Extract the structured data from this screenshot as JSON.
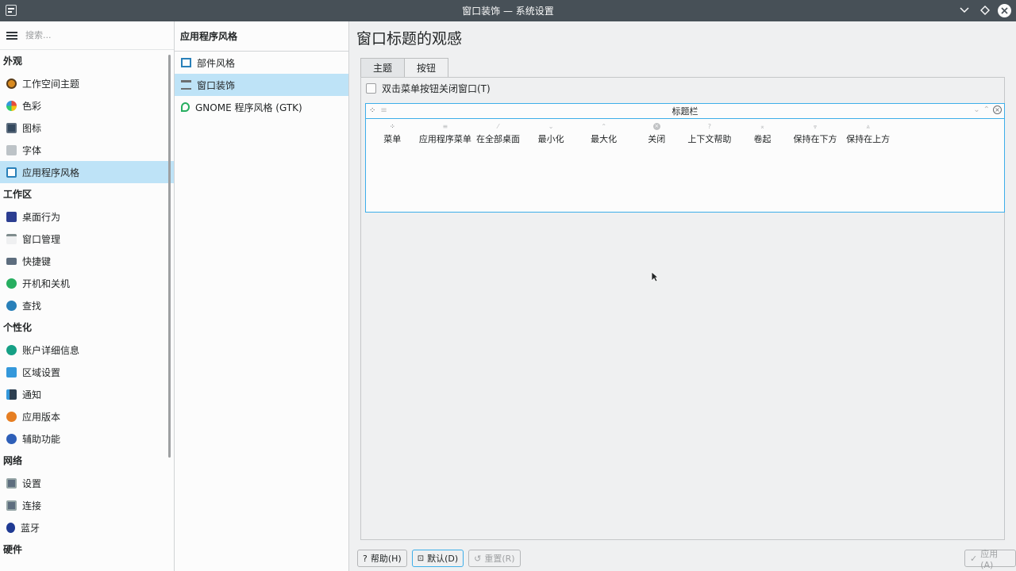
{
  "window": {
    "title": "窗口装饰 — 系统设置"
  },
  "search": {
    "placeholder": "搜索..."
  },
  "sidebar": {
    "categories": [
      {
        "label": "外观",
        "items": [
          {
            "label": "工作空间主题",
            "icon": "workspace-theme-icon"
          },
          {
            "label": "色彩",
            "icon": "colors-icon"
          },
          {
            "label": "图标",
            "icon": "icons-icon"
          },
          {
            "label": "字体",
            "icon": "fonts-icon"
          },
          {
            "label": "应用程序风格",
            "icon": "app-style-icon",
            "selected": true
          }
        ]
      },
      {
        "label": "工作区",
        "items": [
          {
            "label": "桌面行为",
            "icon": "desktop-behavior-icon"
          },
          {
            "label": "窗口管理",
            "icon": "window-management-icon"
          },
          {
            "label": "快捷键",
            "icon": "shortcuts-icon"
          },
          {
            "label": "开机和关机",
            "icon": "startup-shutdown-icon"
          },
          {
            "label": "查找",
            "icon": "search-icon"
          }
        ]
      },
      {
        "label": "个性化",
        "items": [
          {
            "label": "账户详细信息",
            "icon": "account-details-icon"
          },
          {
            "label": "区域设置",
            "icon": "regional-settings-icon"
          },
          {
            "label": "通知",
            "icon": "notifications-icon"
          },
          {
            "label": "应用版本",
            "icon": "application-version-icon"
          },
          {
            "label": "辅助功能",
            "icon": "accessibility-icon"
          }
        ]
      },
      {
        "label": "网络",
        "items": [
          {
            "label": "设置",
            "icon": "network-settings-icon"
          },
          {
            "label": "连接",
            "icon": "connections-icon"
          },
          {
            "label": "蓝牙",
            "icon": "bluetooth-icon"
          }
        ]
      },
      {
        "label": "硬件",
        "items": []
      }
    ]
  },
  "middle": {
    "header": "应用程序风格",
    "items": [
      {
        "label": "部件风格",
        "icon": "widget-style-icon"
      },
      {
        "label": "窗口装饰",
        "icon": "window-decoration-icon",
        "selected": true
      },
      {
        "label": "GNOME 程序风格 (GTK)",
        "icon": "gtk-style-icon"
      }
    ]
  },
  "content": {
    "title": "窗口标题的观感",
    "tabs": [
      {
        "label": "主题"
      },
      {
        "label": "按钮",
        "active": true
      }
    ],
    "checkbox": {
      "label": "双击菜单按钮关闭窗口(T)",
      "checked": false
    },
    "titlebar_label": "标题栏",
    "buttons": [
      {
        "label": "菜单",
        "glyph": "⁘"
      },
      {
        "label": "应用程序菜单",
        "glyph": "≡"
      },
      {
        "label": "在全部桌面",
        "glyph": "⁄"
      },
      {
        "label": "最小化",
        "glyph": "⌄"
      },
      {
        "label": "最大化",
        "glyph": "⌃"
      },
      {
        "label": "关闭",
        "glyph": "×"
      },
      {
        "label": "上下文帮助",
        "glyph": "?"
      },
      {
        "label": "卷起",
        "glyph": "⌅"
      },
      {
        "label": "保持在下方",
        "glyph": "⩔"
      },
      {
        "label": "保持在上方",
        "glyph": "⩓"
      }
    ],
    "footer": {
      "help": "帮助(H)",
      "defaults": "默认(D)",
      "reset": "重置(R)",
      "apply": "应用(A)"
    }
  },
  "colors": {
    "accent": "#3daee9",
    "selection": "#bee3f7",
    "titlebar": "#475057"
  }
}
